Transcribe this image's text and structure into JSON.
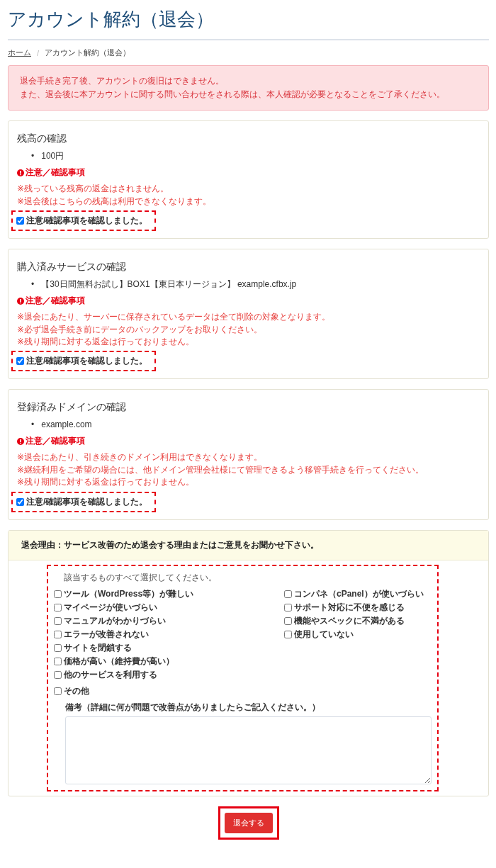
{
  "title": "アカウント解約（退会）",
  "breadcrumb": [
    {
      "label": "ホーム",
      "kind": "link"
    },
    {
      "label": "/",
      "kind": "separator"
    },
    {
      "label": "アカウント解約（退会）",
      "kind": "current"
    }
  ],
  "bullet": "•",
  "alert": [
    "退会手続き完了後、アカウントの復旧はできません。",
    "また、退会後に本アカウントに関する問い合わせをされる際は、本人確認が必要となることをご了承ください。"
  ],
  "sections": [
    {
      "heading": "残高の確認",
      "items": [
        "100円"
      ],
      "notice_title": "注意／確認事項",
      "notices": [
        "※残っている残高の返金はされません。",
        "※退会後はこちらの残高は利用できなくなります。"
      ],
      "confirm": {
        "label": "注意/確認事項を確認しました。",
        "checked": true
      }
    },
    {
      "heading": "購入済みサービスの確認",
      "items": [
        "【30日間無料お試し】BOX1【東日本リージョン】 example.cfbx.jp"
      ],
      "notice_title": "注意／確認事項",
      "notices": [
        "※退会にあたり、サーバーに保存されているデータは全て削除の対象となります。",
        "※必ず退会手続き前にデータのバックアップをお取りください。",
        "※残り期間に対する返金は行っておりません。"
      ],
      "confirm": {
        "label": "注意/確認事項を確認しました。",
        "checked": true
      }
    },
    {
      "heading": "登録済みドメインの確認",
      "items": [
        "example.com"
      ],
      "notice_title": "注意／確認事項",
      "notices": [
        "※退会にあたり、引き続きのドメイン利用はできなくなります。",
        "※継続利用をご希望の場合には、他ドメイン管理会社様にて管理できるよう移管手続きを行ってください。",
        "※残り期間に対する返金は行っておりません。"
      ],
      "confirm": {
        "label": "注意/確認事項を確認しました。",
        "checked": true
      }
    }
  ],
  "reasons": {
    "heading": "退会理由：サービス改善のため退会する理由またはご意見をお聞かせ下さい。",
    "hint": "該当するものすべて選択してください。",
    "columns": [
      [
        {
          "label": "ツール（WordPress等）が難しい",
          "checked": false
        },
        {
          "label": "マイページが使いづらい",
          "checked": false
        },
        {
          "label": "マニュアルがわかりづらい",
          "checked": false
        },
        {
          "label": "エラーが改善されない",
          "checked": false
        },
        {
          "label": "サイトを閉鎖する",
          "checked": false
        },
        {
          "label": "価格が高い（維持費が高い）",
          "checked": false
        },
        {
          "label": "他のサービスを利用する",
          "checked": false
        }
      ],
      [
        {
          "label": "コンパネ（cPanel）が使いづらい",
          "checked": false
        },
        {
          "label": "サポート対応に不便を感じる",
          "checked": false
        },
        {
          "label": "機能やスペックに不満がある",
          "checked": false
        },
        {
          "label": "使用していない",
          "checked": false
        }
      ]
    ],
    "other": {
      "label": "その他",
      "checked": false
    },
    "remarks_label": "備考（詳細に何が問題で改善点がありましたらご記入ください。）"
  },
  "submit": "退会する"
}
